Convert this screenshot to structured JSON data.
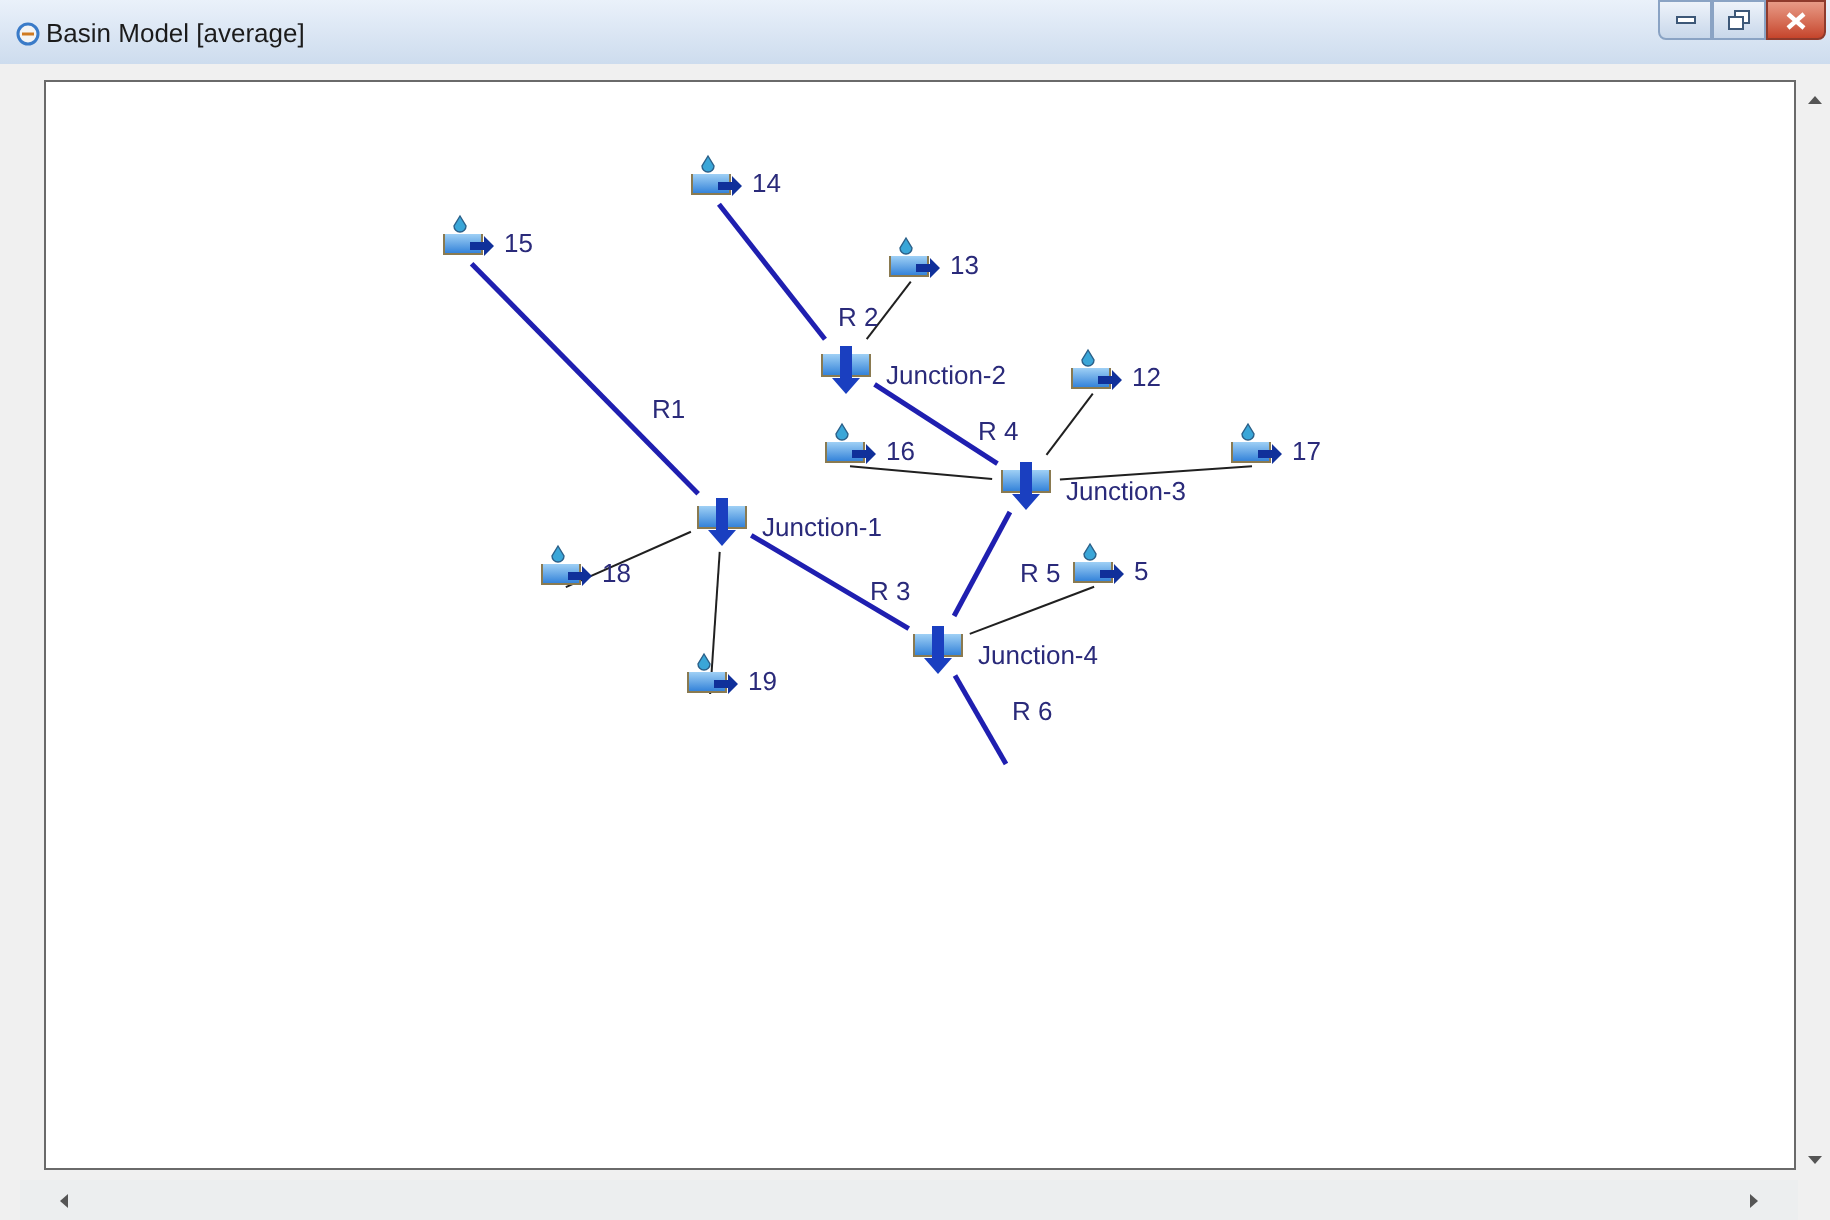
{
  "window": {
    "title": "Basin Model [average]"
  },
  "basin": {
    "subbasins": [
      {
        "label": "15"
      },
      {
        "label": "14"
      },
      {
        "label": "13"
      },
      {
        "label": "12"
      },
      {
        "label": "16"
      },
      {
        "label": "17"
      },
      {
        "label": "18"
      },
      {
        "label": "19"
      },
      {
        "label": "5"
      }
    ],
    "junctions": [
      {
        "label": "Junction-1"
      },
      {
        "label": "Junction-2"
      },
      {
        "label": "Junction-3"
      },
      {
        "label": "Junction-4"
      }
    ],
    "reaches": [
      {
        "label": "R1"
      },
      {
        "label": "R 2"
      },
      {
        "label": "R 3"
      },
      {
        "label": "R 4"
      },
      {
        "label": "R 5"
      },
      {
        "label": "R 6"
      }
    ]
  }
}
